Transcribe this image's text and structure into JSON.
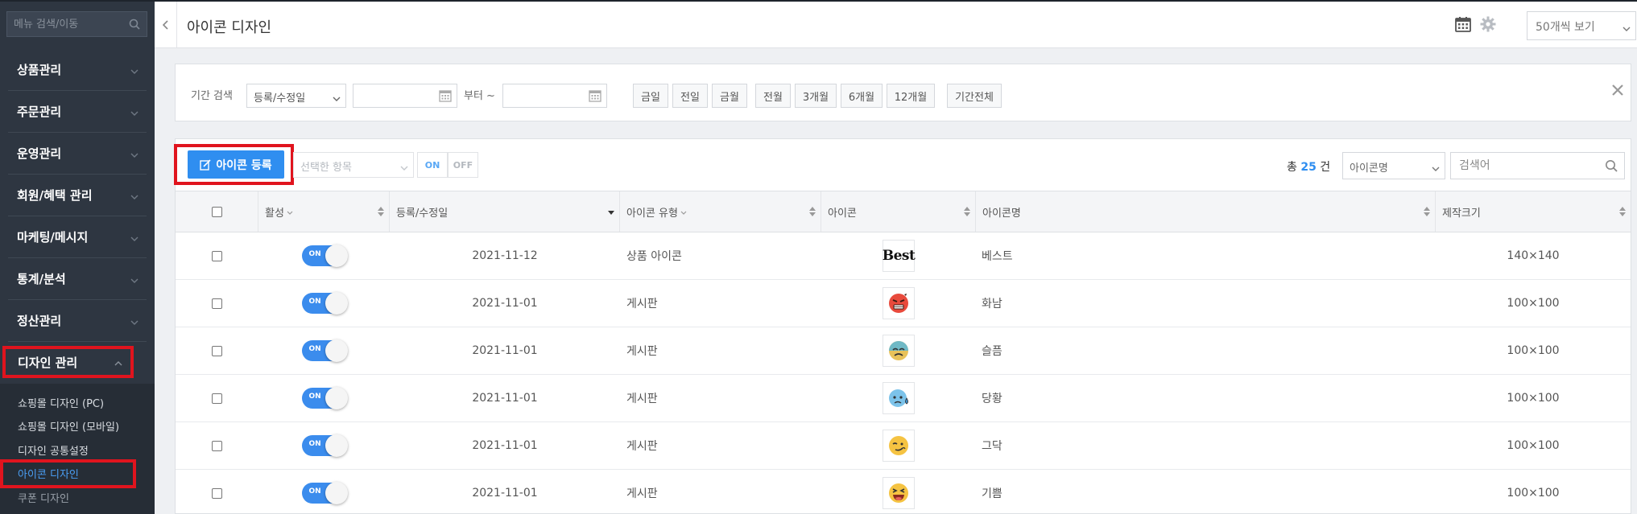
{
  "sidebar": {
    "search_placeholder": "메뉴 검색/이동",
    "menus": [
      {
        "label": "상품관리"
      },
      {
        "label": "주문관리"
      },
      {
        "label": "운영관리"
      },
      {
        "label": "회원/혜택 관리"
      },
      {
        "label": "마케팅/메시지"
      },
      {
        "label": "통계/분석"
      },
      {
        "label": "정산관리"
      },
      {
        "label": "디자인 관리"
      }
    ],
    "submenu": [
      {
        "label": "쇼핑몰 디자인 (PC)"
      },
      {
        "label": "쇼핑몰 디자인 (모바일)"
      },
      {
        "label": "디자인 공통설정"
      },
      {
        "label": "아이콘 디자인"
      },
      {
        "label": "쿠폰 디자인"
      }
    ]
  },
  "header": {
    "title": "아이콘 디자인",
    "view_select": "50개씩 보기"
  },
  "filter": {
    "period_label": "기간 검색",
    "period_type": "등록/수정일",
    "from_label": "부터 ~",
    "buttons": [
      "금일",
      "전일",
      "금월",
      "전월",
      "3개월",
      "6개월",
      "12개월",
      "기간전체"
    ]
  },
  "toolbar": {
    "register_label": "아이콘 등록",
    "selected_items_placeholder": "선택한 항목",
    "on_label": "ON",
    "off_label": "OFF",
    "total_prefix": "총",
    "total_count": "25",
    "total_suffix": "건",
    "search_field": "아이콘명",
    "search_placeholder": "검색어"
  },
  "table": {
    "headers": {
      "active": "활성",
      "date": "등록/수정일",
      "type": "아이콘 유형",
      "icon": "아이콘",
      "name": "아이콘명",
      "size": "제작크기"
    },
    "rows": [
      {
        "toggle": "ON",
        "date": "2021-11-12",
        "type": "상품 아이콘",
        "icon": "best-text-icon",
        "icon_text": "Best",
        "name": "베스트",
        "size": "140×140"
      },
      {
        "toggle": "ON",
        "date": "2021-11-01",
        "type": "게시판",
        "icon": "angry-face-icon",
        "name": "화남",
        "size": "100×100"
      },
      {
        "toggle": "ON",
        "date": "2021-11-01",
        "type": "게시판",
        "icon": "sad-face-icon",
        "name": "슬픔",
        "size": "100×100"
      },
      {
        "toggle": "ON",
        "date": "2021-11-01",
        "type": "게시판",
        "icon": "cold-sweat-face-icon",
        "name": "당황",
        "size": "100×100"
      },
      {
        "toggle": "ON",
        "date": "2021-11-01",
        "type": "게시판",
        "icon": "smirk-face-icon",
        "name": "그닥",
        "size": "100×100"
      },
      {
        "toggle": "ON",
        "date": "2021-11-01",
        "type": "게시판",
        "icon": "laughing-face-icon",
        "name": "기쁨",
        "size": "100×100"
      }
    ]
  },
  "colors": {
    "accent": "#2f8ef0",
    "sidebar_bg": "#2e3641",
    "highlight_red": "#e0141e"
  }
}
